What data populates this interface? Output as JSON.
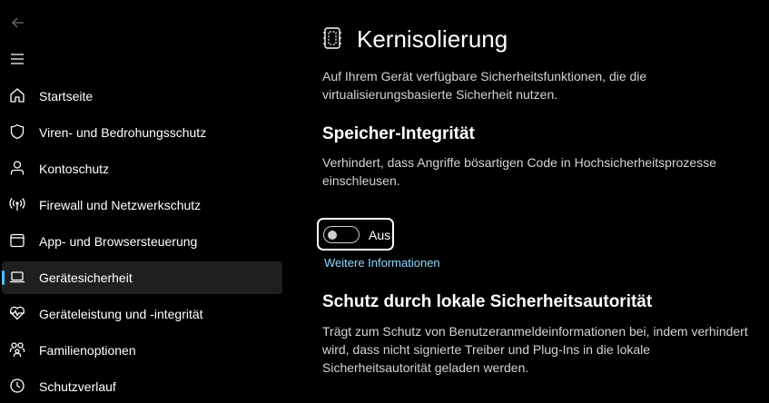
{
  "sidebar": {
    "items": [
      {
        "label": "Startseite",
        "icon": "home-icon"
      },
      {
        "label": "Viren- und Bedrohungsschutz",
        "icon": "shield-icon"
      },
      {
        "label": "Kontoschutz",
        "icon": "person-icon"
      },
      {
        "label": "Firewall und Netzwerkschutz",
        "icon": "wifi-antenna-icon"
      },
      {
        "label": "App- und Browsersteuerung",
        "icon": "browser-window-icon"
      },
      {
        "label": "Gerätesicherheit",
        "icon": "laptop-icon",
        "active": true
      },
      {
        "label": "Geräteleistung und -integrität",
        "icon": "heart-pulse-icon"
      },
      {
        "label": "Familienoptionen",
        "icon": "family-icon"
      },
      {
        "label": "Schutzverlauf",
        "icon": "clock-icon"
      }
    ]
  },
  "main": {
    "title": "Kernisolierung",
    "title_icon": "core-isolation-icon",
    "description": "Auf Ihrem Gerät verfügbare Sicherheitsfunktionen, die die virtualisierungsbasierte Sicherheit nutzen.",
    "memory_integrity": {
      "title": "Speicher-Integrität",
      "description": "Verhindert, dass Angriffe bösartigen Code in Hochsicherheitsprozesse einschleusen.",
      "toggle_state": "Aus",
      "link": "Weitere Informationen"
    },
    "lsa": {
      "title": "Schutz durch lokale Sicherheitsautorität",
      "description": "Trägt zum Schutz von Benutzeranmeldeinformationen bei, indem verhindert wird, dass nicht signierte Treiber und Plug-Ins in die lokale Sicherheitsautorität geladen werden."
    }
  },
  "colors": {
    "background": "#000000",
    "active_item": "#1f1f1f",
    "accent": "#4cc2ff",
    "link": "#8fd7ff"
  }
}
